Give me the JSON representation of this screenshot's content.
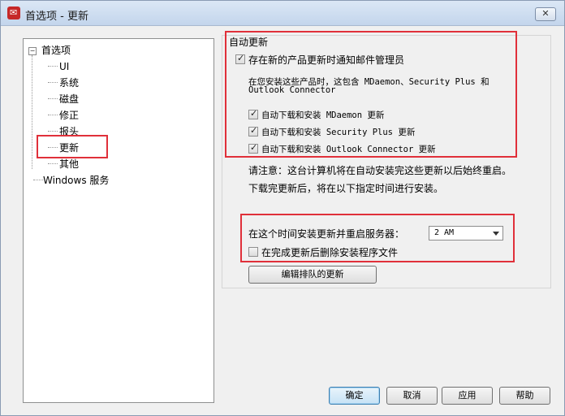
{
  "window": {
    "title": "首选项 - 更新",
    "close_glyph": "✕"
  },
  "tree": {
    "root": "首选项",
    "expander": "−",
    "children": [
      "UI",
      "系统",
      "磁盘",
      "修正",
      "报头",
      "更新",
      "其他"
    ],
    "sibling": "Windows 服务",
    "selected": "更新"
  },
  "auto_update": {
    "group_title": "自动更新",
    "notify_label": "存在新的产品更新时通知邮件管理员",
    "notify_checked": true,
    "info_line1": "在您安装这些产品时，这包含 MDaemon、Security Plus 和",
    "info_line2": "Outlook Connector",
    "download_mdaemon": "自动下载和安装 MDaemon 更新",
    "download_mdaemon_checked": true,
    "download_secplus": "自动下载和安装 Security Plus 更新",
    "download_secplus_checked": true,
    "download_outlook": "自动下载和安装 Outlook Connector 更新",
    "download_outlook_checked": true
  },
  "notes": {
    "line1": "请注意：这台计算机将在自动安装完这些更新以后始终重启。",
    "line2": "下载完更新后，将在以下指定时间进行安装。"
  },
  "schedule": {
    "time_label": "在这个时间安装更新并重启服务器：",
    "time_value": "2 AM",
    "delete_label": "在完成更新后删除安装程序文件",
    "delete_checked": false
  },
  "buttons": {
    "edit_queue": "编辑排队的更新",
    "ok": "确定",
    "cancel": "取消",
    "apply": "应用",
    "help": "帮助"
  }
}
